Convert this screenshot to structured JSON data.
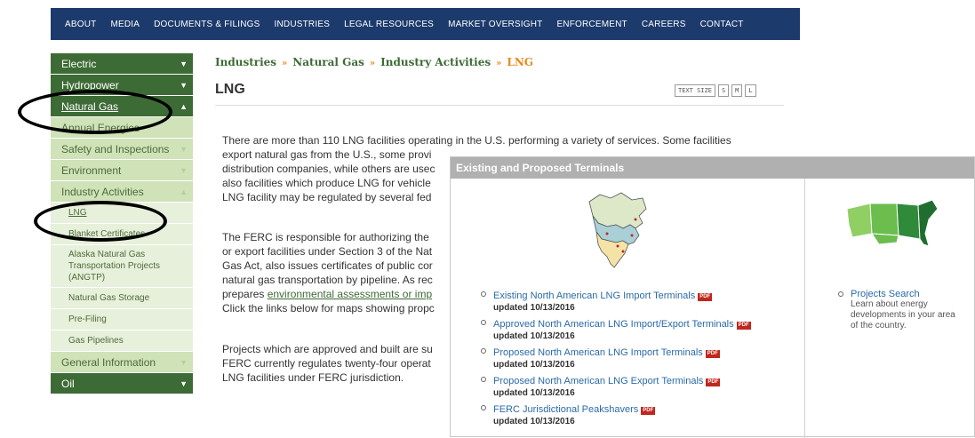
{
  "topnav": {
    "items": [
      "ABOUT",
      "MEDIA",
      "DOCUMENTS & FILINGS",
      "INDUSTRIES",
      "LEGAL RESOURCES",
      "MARKET OVERSIGHT",
      "ENFORCEMENT",
      "CAREERS",
      "CONTACT"
    ]
  },
  "sidebar": {
    "electric": "Electric",
    "hydropower": "Hydropower",
    "natural_gas": "Natural Gas",
    "annual_energies": "Annual Energies",
    "safety": "Safety and Inspections",
    "environment": "Environment",
    "industry_activities": "Industry Activities",
    "lng": "LNG",
    "blanket": "Blanket Certificates",
    "alaska": "Alaska Natural Gas Transportation Projects (ANGTP)",
    "storage": "Natural Gas Storage",
    "prefiling": "Pre-Filing",
    "pipelines": "Gas Pipelines",
    "general": "General Information",
    "oil": "Oil"
  },
  "breadcrumb": {
    "items": [
      "Industries",
      "Natural Gas",
      "Industry Activities"
    ],
    "current": "LNG",
    "separator": "»"
  },
  "page": {
    "title": "LNG",
    "text_size_label": "TEXT SIZE",
    "text_sizes": [
      "S",
      "M",
      "L"
    ]
  },
  "content": {
    "p1": [
      "There are more than 110 LNG facilities operating in the U.S. performing a variety of services. Some facilities",
      "export natural gas from the U.S., some provi",
      "distribution companies, while others are usec",
      "also facilities which produce LNG for vehicle",
      "LNG facility may be regulated by several fed"
    ],
    "p2": [
      "The FERC is responsible for authorizing the",
      "or export facilities under Section 3 of the Nat",
      "Gas Act, also issues certificates of public cor",
      "natural gas transportation by pipeline. As rec"
    ],
    "p2_line5_pre": "prepares ",
    "p2_link": "environmental assessments or imp",
    "p2_line6": "Click the links below for maps showing propc",
    "p3": [
      "Projects which are approved and built are su",
      "FERC currently regulates twenty-four operat",
      "LNG facilities under FERC jurisdiction."
    ]
  },
  "terminals": {
    "header": "Existing and Proposed Terminals",
    "pdf_badge": "PDF",
    "links": [
      {
        "label": "Existing North American LNG Import Terminals",
        "date": "updated 10/13/2016"
      },
      {
        "label": "Approved North American LNG Import/Export Terminals",
        "date": "updated 10/13/2016"
      },
      {
        "label": "Proposed North American LNG Import Terminals",
        "date": "updated 10/13/2016"
      },
      {
        "label": "Proposed North American LNG Export Terminals",
        "date": "updated 10/13/2016"
      },
      {
        "label": "FERC Jurisdictional Peakshavers",
        "date": "updated 10/13/2016"
      }
    ],
    "projects_link": "Projects Search",
    "projects_desc": [
      "Learn about energy",
      "developments in your area",
      "of the country."
    ]
  },
  "colors": {
    "nav_bg": "#1d3a6c",
    "sidebar_dark": "#3d6b35",
    "sidebar_mid": "#cfe2b8",
    "sidebar_light": "#e7f0db",
    "breadcrumb": "#3d6b35",
    "breadcrumb_accent": "#e8891c",
    "link": "#2a6aa8",
    "pdf": "#c0281e",
    "overlay_header": "#b0b0b0"
  },
  "icons": [
    "caret-down-icon",
    "caret-up-icon",
    "pdf-icon",
    "north-america-map-icon",
    "us-map-icon"
  ]
}
